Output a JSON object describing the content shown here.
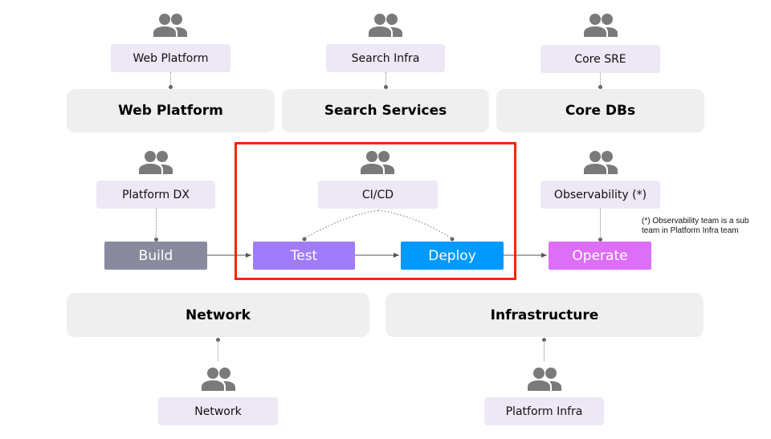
{
  "groups": {
    "web_platform": "Web Platform",
    "search_services": "Search Services",
    "core_dbs": "Core DBs",
    "network": "Network",
    "infrastructure": "Infrastructure"
  },
  "teams": {
    "web_platform": "Web Platform",
    "search_infra": "Search Infra",
    "core_sre": "Core SRE",
    "platform_dx": "Platform DX",
    "cicd": "CI/CD",
    "observability": "Observability (*)",
    "network": "Network",
    "platform_infra": "Platform Infra"
  },
  "pipeline": {
    "build": "Build",
    "test": "Test",
    "deploy": "Deploy",
    "operate": "Operate"
  },
  "note": {
    "line1": "(*) Observability team is a sub",
    "line2": "team in Platform Infra team"
  },
  "colors": {
    "build": "#8a8a9e",
    "test": "#a07cfb",
    "deploy": "#0099ff",
    "operate": "#dd6ef7",
    "team_box": "#ede7f6",
    "group_box": "#efefef",
    "highlight": "#ff2200",
    "icon": "#7a7a7a"
  },
  "icons": {
    "team": "people-group-icon"
  }
}
